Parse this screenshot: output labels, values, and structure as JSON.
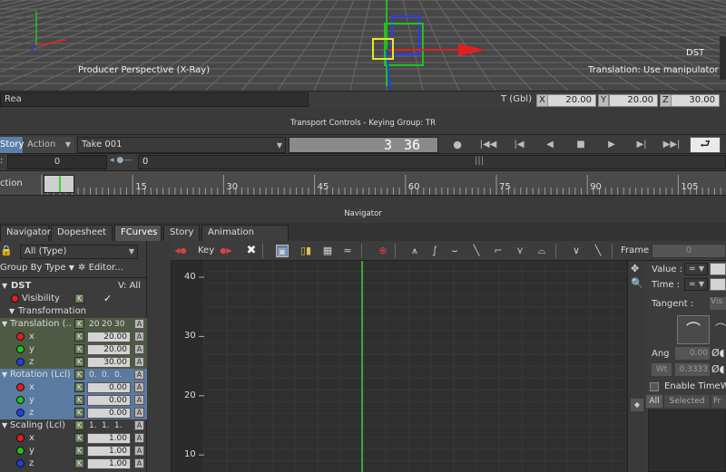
{
  "viewport": {
    "camera_label": "Producer Perspective (X-Ray)",
    "object_label": "DST",
    "mode_label": "Translation: Use manipulator"
  },
  "status_row": {
    "left_field": "Rea",
    "transform_label": "T (Gbl)",
    "x_label": "X",
    "x_value": "20.00",
    "y_label": "Y",
    "y_value": "20.00",
    "z_label": "Z",
    "z_value": "30.00"
  },
  "transport_title": "Transport Controls  -  Keying Group: TR",
  "transport": {
    "story_tab": "Story",
    "action_tab": "Action",
    "take": "Take 001",
    "frame_display_a": "3",
    "frame_display_b": "36"
  },
  "range": {
    "left_value": "0",
    "right_value": "0"
  },
  "ruler": {
    "label": "ction",
    "ticks": [
      "15",
      "30",
      "45",
      "60",
      "75",
      "90",
      "105"
    ]
  },
  "navigator_title": "Navigator",
  "tabs": [
    "Navigator",
    "Dopesheet",
    "FCurves",
    "Story",
    "Animation Trigger"
  ],
  "active_tab": "FCurves",
  "left_panel": {
    "filter": "All (Type)",
    "group_by": "Group By Type",
    "editor": "Editor...",
    "object": "DST",
    "view_all": "V: All",
    "rows": [
      {
        "label": "Visibility",
        "k": "K",
        "check": "✓"
      },
      {
        "label": "Transformation"
      },
      {
        "label": "Translation (...",
        "k": "K",
        "v1": "20",
        "v2": "20",
        "v3": "30",
        "a": "A"
      },
      {
        "label": "x",
        "k": "K",
        "value": "20.00",
        "a": "A"
      },
      {
        "label": "y",
        "k": "K",
        "value": "20.00",
        "a": "A"
      },
      {
        "label": "z",
        "k": "K",
        "value": "30.00",
        "a": "A"
      },
      {
        "label": "Rotation (Lcl)",
        "k": "K",
        "v1": "0.",
        "v2": "0.",
        "v3": "0.",
        "a": "A"
      },
      {
        "label": "x",
        "k": "K",
        "value": "0.00",
        "a": "A"
      },
      {
        "label": "y",
        "k": "K",
        "value": "0.00",
        "a": "A"
      },
      {
        "label": "z",
        "k": "K",
        "value": "0.00",
        "a": "A"
      },
      {
        "label": "Scaling (Lcl)",
        "k": "K",
        "v1": "1.",
        "v2": "1.",
        "v3": "1.",
        "a": "A"
      },
      {
        "label": "x",
        "k": "K",
        "value": "1.00",
        "a": "A"
      },
      {
        "label": "y",
        "k": "K",
        "value": "1.00",
        "a": "A"
      },
      {
        "label": "z",
        "k": "K",
        "value": "1.00",
        "a": "A"
      }
    ]
  },
  "fc_toolbar": {
    "key_label": "Key",
    "frame_label": "Frame",
    "frame_value": "0"
  },
  "graph": {
    "y_ticks": [
      "40",
      "30",
      "20",
      "10"
    ]
  },
  "right_panel": {
    "value_label": "Value :",
    "eq": "=",
    "time_label": "Time :",
    "tangent_label": "Tangent :",
    "tangent_value": "Vis",
    "ang_label": "Ang",
    "ang_value": "0.00",
    "wt_label": "Wt",
    "wt_value": "0.3333",
    "enable_timewarp": "Enable TimeWa",
    "all_tab": "All",
    "selected_tab": "Selected",
    "fr_tab": "Fr"
  },
  "colors": {
    "x_axis": "#e02020",
    "y_axis": "#20c020",
    "z_axis": "#2040e0",
    "playhead": "#3ccf3c",
    "selection_yellow": "#e8e820"
  }
}
